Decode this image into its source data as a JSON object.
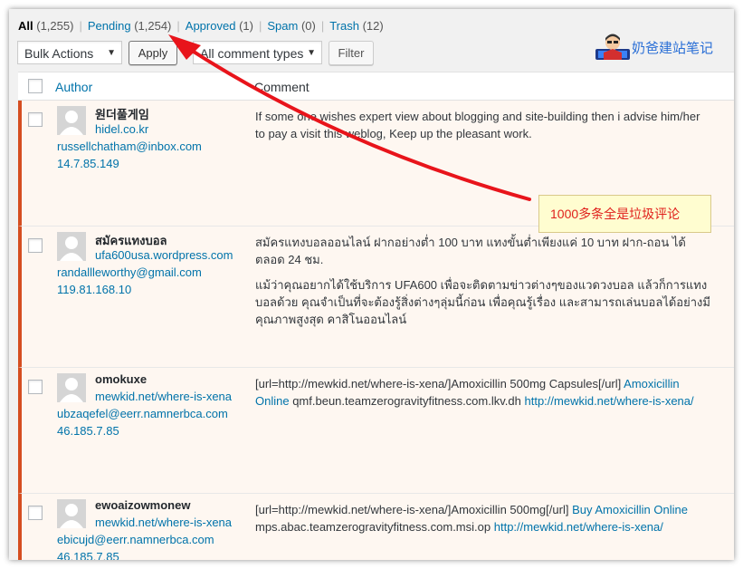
{
  "filters": {
    "all": {
      "label": "All",
      "count": "(1,255)"
    },
    "pending": {
      "label": "Pending",
      "count": "(1,254)"
    },
    "approved": {
      "label": "Approved",
      "count": "(1)"
    },
    "spam": {
      "label": "Spam",
      "count": "(0)"
    },
    "trash": {
      "label": "Trash",
      "count": "(12)"
    }
  },
  "toolbar": {
    "bulk_actions": "Bulk Actions",
    "apply_label": "Apply",
    "comment_types": "All comment types",
    "filter_label": "Filter"
  },
  "logo": {
    "text": "奶爸建站笔记"
  },
  "table": {
    "col_author": "Author",
    "col_comment": "Comment"
  },
  "annotation": {
    "text": "1000多条全是垃圾评论",
    "color": "#e0201c"
  },
  "comments": [
    {
      "name": "원더풀게임",
      "url": "hidel.co.kr",
      "email": "russellchatham@inbox.com",
      "ip": "14.7.85.149",
      "p1": "If some one wishes expert view about blogging and site-building then i advise him/her to pay a visit this weblog, Keep up the pleasant work."
    },
    {
      "name": "สมัครแทงบอล",
      "url": "ufa600usa.wordpress.com",
      "email": "randallleworthy@gmail.com",
      "ip": "119.81.168.10",
      "p1": "สมัครแทงบอลออนไลน์ ฝากอย่างต่ำ 100 บาท แทงขั้นต่ำเพียงแค่ 10 บาท ฝาก-ถอน ได้ตลอด 24 ชม.",
      "p2": "แม้ว่าคุณอยากได้ใช้บริการ UFA600 เพื่อจะติดตามข่าวต่างๆของแวดวงบอล แล้วก็การแทงบอลด้วย คุณจำเป็นที่จะต้องรู้สิ่งต่างๆลุ่มนี้ก่อน เพื่อคุณรู้เรื่อง และสามารถเล่นบอลได้อย่างมีคุณภาพสูงสุด คาสิโนออนไลน์"
    },
    {
      "name": "omokuxe",
      "url": "mewkid.net/where-is-xena",
      "email": "ubzaqefel@eerr.namnerbca.com",
      "ip": "46.185.7.85",
      "text_a": "[url=http://mewkid.net/where-is-xena/]Amoxicillin 500mg Capsules[/url]",
      "link_a": "Amoxicillin Online",
      "text_b": "qmf.beun.teamzerogravityfitness.com.lkv.dh",
      "link_b": "http://mewkid.net/where-is-xena/"
    },
    {
      "name": "ewoaizowmonew",
      "url": "mewkid.net/where-is-xena",
      "email": "ebicujd@eerr.namnerbca.com",
      "ip": "46.185.7.85",
      "text_a": "[url=http://mewkid.net/where-is-xena/]Amoxicillin 500mg[/url]",
      "link_a": "Buy Amoxicillin Online",
      "text_b": "mps.abac.teamzerogravityfitness.com.msi.op",
      "link_b": "http://mewkid.net/where-is-xena/"
    }
  ]
}
